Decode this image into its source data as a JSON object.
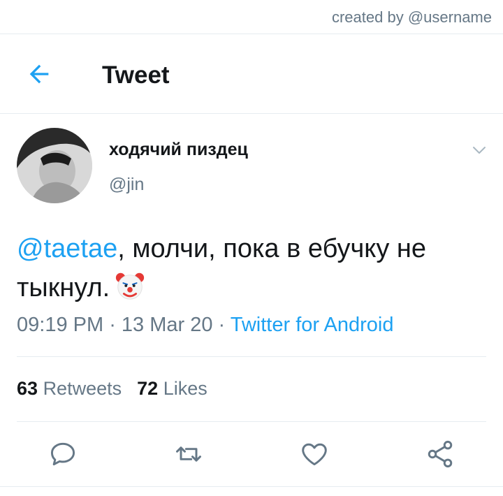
{
  "watermark": "created by @username",
  "header": {
    "title": "Tweet"
  },
  "author": {
    "display_name": "ходячий пиздец",
    "handle": "@jin"
  },
  "tweet": {
    "mention": "@taetae",
    "text_after_mention": ", молчи, пока в ебучку не тыкнул.",
    "emoji": "clown-face-icon"
  },
  "meta": {
    "time": "09:19 PM",
    "sep1": " · ",
    "date": "13 Mar 20",
    "sep2": " · ",
    "source": "Twitter for Android"
  },
  "stats": {
    "retweets_count": "63",
    "retweets_label": "Retweets",
    "likes_count": "72",
    "likes_label": "Likes"
  },
  "colors": {
    "accent": "#1da1f2",
    "secondary_text": "#657786",
    "divider": "#e6ecf0"
  }
}
